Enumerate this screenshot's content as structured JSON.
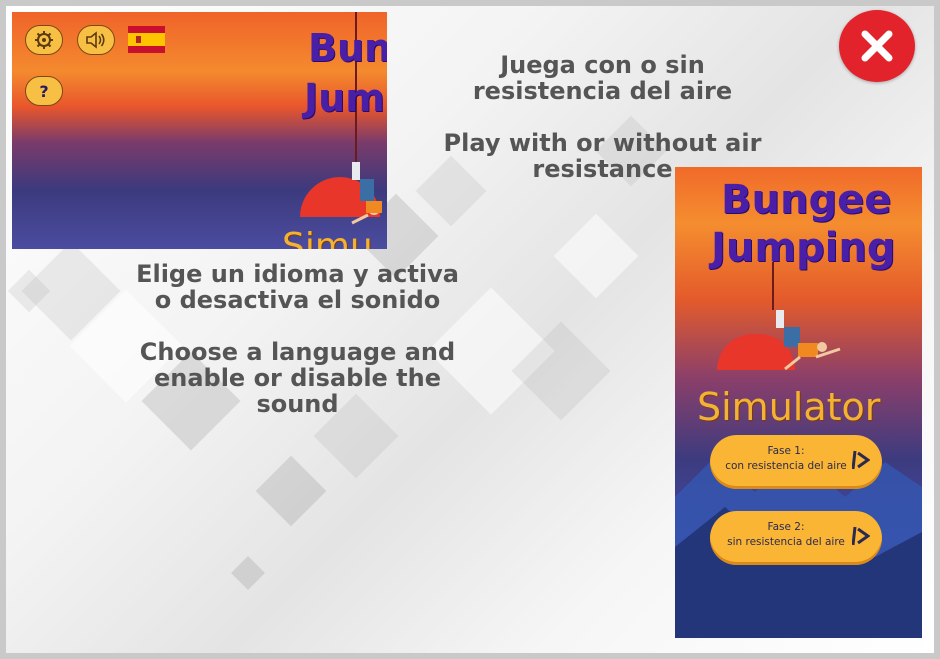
{
  "help": {
    "air_es": "Juega con o sin resistencia del aire",
    "air_en": "Play with or without air resistance",
    "lang_es": "Elige un idioma y activa o desactiva el sonido",
    "lang_en": "Choose a language and enable or disable the sound"
  },
  "close_button": {
    "icon": "x-icon",
    "color": "#e3232b"
  },
  "left_screenshot": {
    "title_line1": "Bunge",
    "title_line2": "Jump",
    "partial_sim": "Simu",
    "buttons": [
      "settings-icon",
      "speaker-icon",
      "spain-flag-icon",
      "help-icon"
    ],
    "help_symbol": "?"
  },
  "right_screenshot": {
    "title_line1": "Bungee",
    "title_line2": "Jumping",
    "title_line3": "Simulator",
    "phase1": {
      "label": "Fase 1:",
      "sub": "con resistencia del aire"
    },
    "phase2": {
      "label": "Fase 2:",
      "sub": "sin resistencia del aire"
    }
  },
  "colors": {
    "text": "#555555",
    "button": "#fbb534",
    "title": "#4a1fa8",
    "sim": "#f3b233"
  }
}
